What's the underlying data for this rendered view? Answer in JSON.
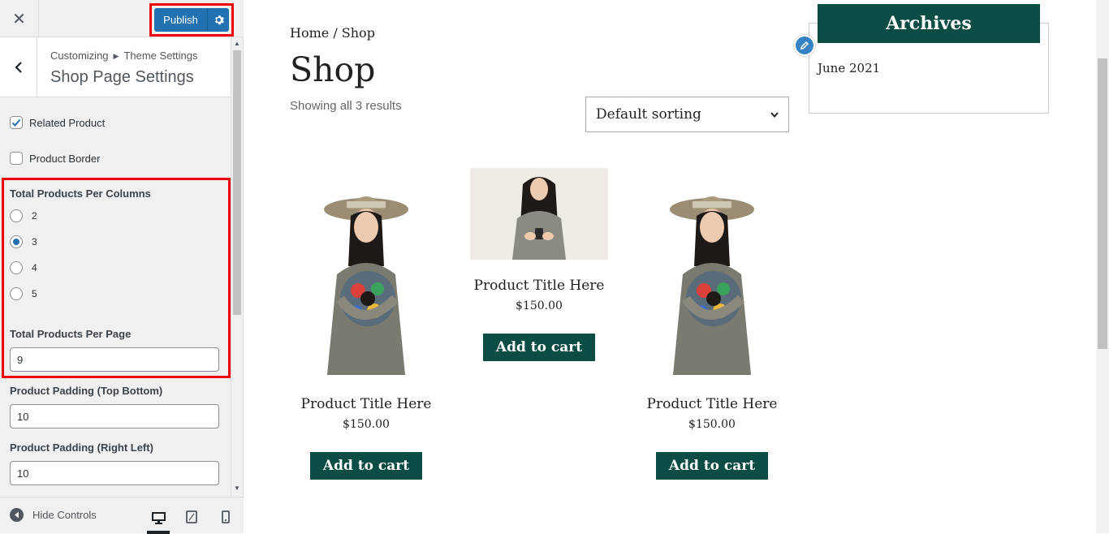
{
  "topbar": {
    "publish_label": "Publish"
  },
  "section": {
    "breadcrumb_root": "Customizing",
    "breadcrumb_parent": "Theme Settings",
    "title": "Shop Page Settings"
  },
  "controls": {
    "related_product": {
      "label": "Related Product",
      "checked": true
    },
    "product_border": {
      "label": "Product Border",
      "checked": false
    },
    "columns": {
      "label": "Total Products Per Columns",
      "options": [
        "2",
        "3",
        "4",
        "5"
      ],
      "selected": "3"
    },
    "per_page": {
      "label": "Total Products Per Page",
      "value": "9"
    },
    "padding_tb": {
      "label": "Product Padding (Top Bottom)",
      "value": "10"
    },
    "padding_rl": {
      "label": "Product Padding (Right Left)",
      "value": "10"
    }
  },
  "footer": {
    "hide_controls": "Hide Controls",
    "devices": [
      "desktop-icon",
      "tablet-icon",
      "mobile-icon"
    ]
  },
  "shop": {
    "breadcrumb": "Home / Shop",
    "title": "Shop",
    "result_count": "Showing all 3 results",
    "sorting": "Default sorting",
    "products": [
      {
        "title": "Product Title Here",
        "price": "$150.00",
        "button": "Add to cart"
      },
      {
        "title": "Product Title Here",
        "price": "$150.00",
        "button": "Add to cart"
      },
      {
        "title": "Product Title Here",
        "price": "$150.00",
        "button": "Add to cart"
      }
    ]
  },
  "sidebar_widget": {
    "title": "Archives",
    "items": [
      "June 2021"
    ]
  },
  "colors": {
    "accent": "#2271b1",
    "brand_green": "#0b4d44",
    "highlight": "#ee0000"
  }
}
